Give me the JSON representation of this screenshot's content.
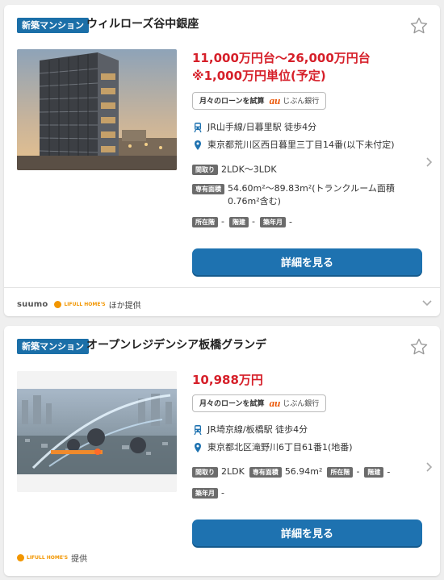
{
  "listings": [
    {
      "badge": "新築マンション",
      "title": "ウィルローズ谷中銀座",
      "price_line1": "11,000万円台～26,000万円台",
      "price_line2": "※1,000万円単位(予定)",
      "loan": {
        "text": "月々のローンを試算",
        "brand": "au",
        "bank": "じぶん銀行"
      },
      "station": "JR山手線/日暮里駅 徒歩4分",
      "address": "東京都荒川区西日暮里三丁目14番(以下未付定)",
      "layout_label": "間取り",
      "layout": "2LDK～3LDK",
      "area_label": "専有面積",
      "area": "54.60m²～89.83m²(トランクルーム面積0.76m²含む)",
      "floor_label": "所在階",
      "floor": "-",
      "stories_label": "階建",
      "stories": "-",
      "built_label": "築年月",
      "built": "-",
      "button": "詳細を見る",
      "source_suumo": "suumo",
      "source_homes": "LIFULL HOME'S",
      "source_suffix": "ほか提供"
    },
    {
      "badge": "新築マンション",
      "title": "オープンレジデンシア板橋グランデ",
      "price_line1": "10,988万円",
      "loan": {
        "text": "月々のローンを試算",
        "brand": "au",
        "bank": "じぶん銀行"
      },
      "station": "JR埼京線/板橋駅 徒歩4分",
      "address": "東京都北区滝野川6丁目61番1(地番)",
      "layout_label": "間取り",
      "layout": "2LDK",
      "area_label": "専有面積",
      "area": "56.94m²",
      "floor_label": "所在階",
      "floor": "-",
      "stories_label": "階建",
      "stories": "-",
      "built_label": "築年月",
      "built": "-",
      "button": "詳細を見る",
      "source_homes": "LIFULL HOME'S",
      "source_suffix": "提供"
    }
  ],
  "colors": {
    "accent": "#1e72b0",
    "price": "#d6202a",
    "badge": "#1b6fa8",
    "tag": "#6b6b6b",
    "au": "#eb5505",
    "homes": "#f29600"
  },
  "icons": [
    "star-icon",
    "train-icon",
    "location-pin-icon",
    "chevron-right-icon",
    "chevron-down-icon"
  ]
}
